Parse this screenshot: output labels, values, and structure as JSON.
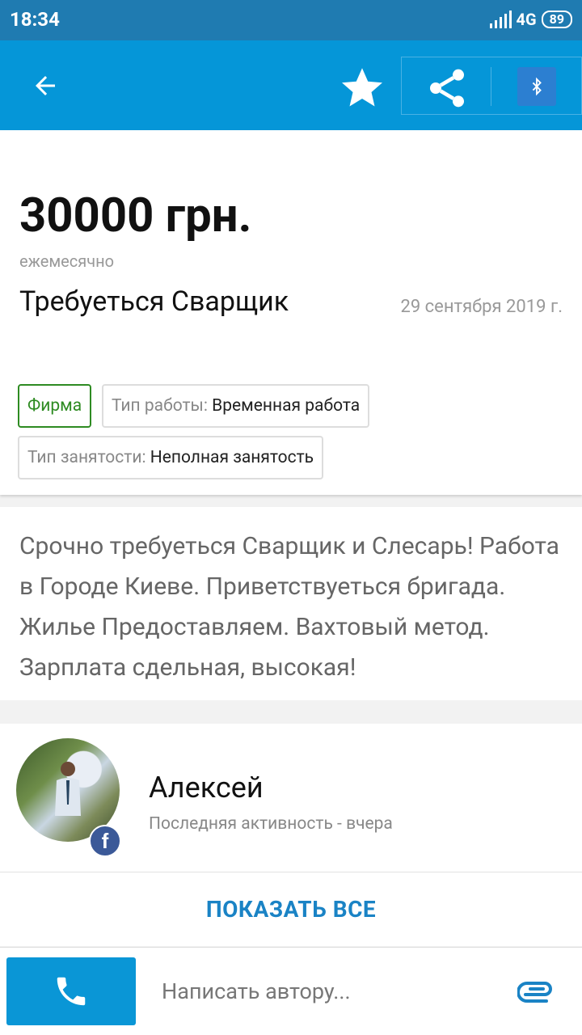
{
  "status_bar": {
    "time": "18:34",
    "network": "4G",
    "battery": "89"
  },
  "listing": {
    "price": "30000 грн.",
    "period": "ежемесячно",
    "title": "Требуеться Сварщик",
    "date": "29 сентября 2019 г.",
    "tags": [
      {
        "label": "Фирма"
      },
      {
        "key": "Тип работы:",
        "value": "Временная работа"
      },
      {
        "key": "Тип занятости:",
        "value": "Неполная занятость"
      }
    ],
    "description": "Срочно требуеться Сварщик и Слесарь! Работа в Городе Киеве. Приветствуеться бригада. Жилье Предоставляем. Вахтовый метод. Зарплата сдельная, высокая!"
  },
  "author": {
    "name": "Алексей",
    "activity": "Последняя активность - вчера",
    "badge": "f"
  },
  "show_all_label": "ПОКАЗАТЬ ВСЕ",
  "bottom": {
    "message_placeholder": "Написать автору..."
  },
  "icons": {
    "back": "back-arrow-icon",
    "favorite": "star-icon",
    "share": "share-icon",
    "bluetooth": "bluetooth-icon",
    "call": "phone-icon",
    "attach": "paperclip-icon"
  },
  "colors": {
    "primary": "#0596d8",
    "status_bar": "#1f7bb1",
    "accent_green": "#2e8b22",
    "link": "#1a83c5"
  }
}
